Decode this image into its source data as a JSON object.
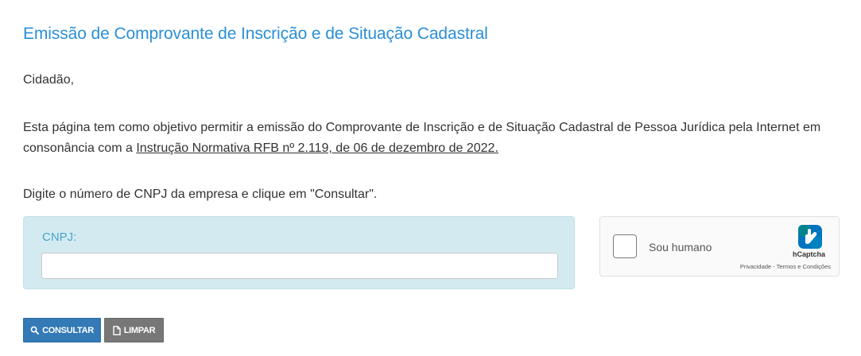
{
  "page": {
    "title": "Emissão de Comprovante de Inscrição e de Situação Cadastral",
    "greeting": "Cidadão,",
    "intro_text": "Esta página tem como objetivo permitir a emissão do Comprovante de Inscrição e de Situação Cadastral de Pessoa Jurídica pela Internet em consonância com a ",
    "intro_link": "Instrução Normativa RFB nº 2.119, de 06 de dezembro de 2022.",
    "instruction": "Digite o número de CNPJ da empresa e clique em \"Consultar\"."
  },
  "form": {
    "cnpj_label": "CNPJ:",
    "cnpj_value": "",
    "cnpj_placeholder": ""
  },
  "captcha": {
    "checkbox_label": "Sou humano",
    "brand": "hCaptcha",
    "privacy_link": "Privacidade",
    "separator": " - ",
    "terms_link": "Termos e Condições"
  },
  "buttons": {
    "consultar_label": "CONSULTAR",
    "consultar_icon": "search-icon",
    "limpar_label": "LIMPAR",
    "limpar_icon": "file-icon"
  },
  "colors": {
    "title": "#2a8fd6",
    "cnpj_panel": "#d3ebf0",
    "primary_button": "#337ab7",
    "secondary_button": "#777777"
  }
}
